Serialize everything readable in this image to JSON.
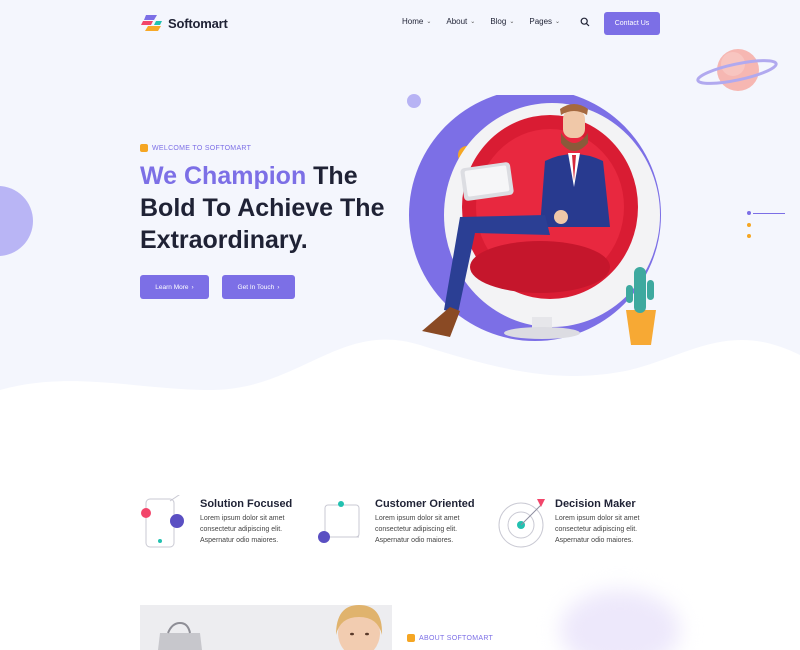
{
  "brand": {
    "name": "Softomart",
    "accent": "#7c6fe6"
  },
  "nav": {
    "items": [
      {
        "label": "Home",
        "icon": "chevron-down-icon"
      },
      {
        "label": "About",
        "icon": "chevron-down-icon"
      },
      {
        "label": "Blog",
        "icon": "chevron-down-icon"
      },
      {
        "label": "Pages",
        "icon": "chevron-down-icon"
      }
    ],
    "search_icon": "search-icon",
    "contact_label": "Contact Us"
  },
  "hero": {
    "eyebrow": "WELCOME TO SOFTOMART",
    "headline_accent": "We Champion",
    "headline_line1_rest": " The",
    "headline_line2": "Bold To Achieve The",
    "headline_line3": "Extraordinary.",
    "button_primary": "Learn More",
    "button_secondary": "Get In Touch"
  },
  "features": [
    {
      "title": "Solution Focused",
      "desc": "Lorem ipsum dolor sit amet consectetur adipiscing elit. Aspernatur odio maiores.",
      "icon": "mobile-chart-icon"
    },
    {
      "title": "Customer Oriented",
      "desc": "Lorem ipsum dolor sit amet consectetur adipiscing elit. Aspernatur odio maiores.",
      "icon": "connected-nodes-icon"
    },
    {
      "title": "Decision Maker",
      "desc": "Lorem ipsum dolor sit amet consectetur adipiscing elit. Aspernatur odio maiores.",
      "icon": "target-icon"
    }
  ],
  "about": {
    "eyebrow": "ABOUT SOFTOMART"
  }
}
